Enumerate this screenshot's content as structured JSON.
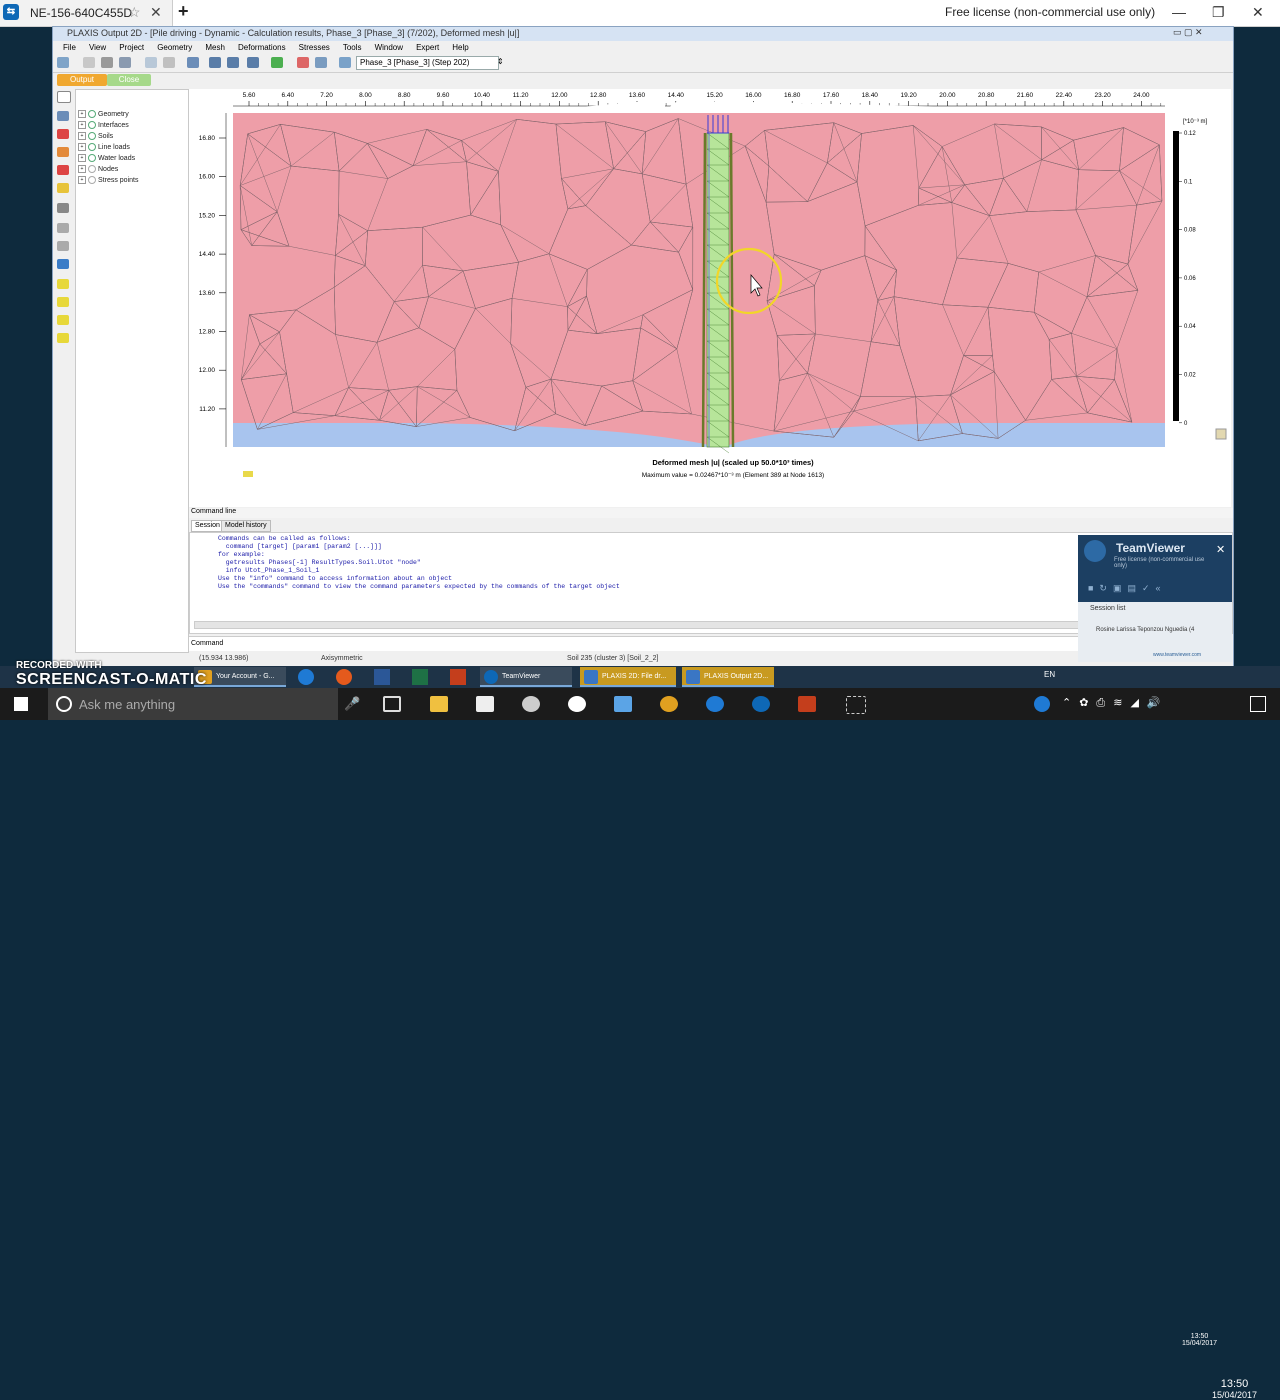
{
  "teamviewer_bar": {
    "session_tab": "NE-156-640C455D",
    "license": "Free license (non-commercial use only)"
  },
  "plaxis": {
    "title": "PLAXIS Output 2D - [Pile driving - Dynamic - Calculation results, Phase_3 [Phase_3] (7/202), Deformed mesh |u|]",
    "menu": [
      "File",
      "View",
      "Project",
      "Geometry",
      "Mesh",
      "Deformations",
      "Stresses",
      "Tools",
      "Window",
      "Expert",
      "Help"
    ],
    "phase_select": "Phase_3 [Phase_3] (Step 202)",
    "tabs": {
      "output": "Output",
      "close": "Close"
    },
    "tree": [
      "Geometry",
      "Interfaces",
      "Soils",
      "Line loads",
      "Water loads",
      "Nodes",
      "Stress points"
    ],
    "x_ticks": [
      "5.60",
      "6.40",
      "7.20",
      "8.00",
      "8.80",
      "9.60",
      "10.40",
      "11.20",
      "12.00",
      "12.80",
      "13.60",
      "14.40",
      "15.20",
      "16.00",
      "16.80",
      "17.60",
      "18.40",
      "19.20",
      "20.00",
      "20.80",
      "21.60",
      "22.40",
      "23.20",
      "24.00"
    ],
    "y_ticks": [
      "16.80",
      "16.00",
      "15.20",
      "14.40",
      "13.60",
      "12.80",
      "12.00",
      "11.20"
    ],
    "legend_unit": "[*10⁻³ m]",
    "legend_ticks": [
      "0.12",
      "0.1",
      "0.08",
      "0.06",
      "0.04",
      "0.02",
      "0"
    ],
    "caption": "Deformed mesh |u| (scaled up 50.0*10³ times)",
    "subcaption": "Maximum value = 0.02467*10⁻³ m (Element 389 at Node 1613)",
    "command_line_title": "Command line",
    "cmd_tabs": [
      "Session",
      "Model history"
    ],
    "log": [
      "Commands can be called as follows:",
      "  command [target] [param1 [param2 [...]]]",
      "for example:",
      "  getresults Phases[-1] ResultTypes.Soil.Utot \"node\"",
      "  info Utot_Phase_1_Soil_1",
      "Use the \"info\" command to access information about an object",
      "Use the \"commands\" command to view the command parameters expected by the commands of the target object"
    ],
    "command_label": "Command",
    "status": {
      "coords": "(15.934 13.986)",
      "mode": "Axisymmetric",
      "soil": "Soil 235 (cluster 3) [Soil_2_2]"
    }
  },
  "teamviewer_panel": {
    "title": "TeamViewer",
    "subtitle": "Free license (non-commercial use only)",
    "session_list": "Session list",
    "user": "Rosine Larissa Teponzou Nguedia (4",
    "link": "www.teamviewer.com"
  },
  "taskbar": {
    "search_placeholder": "Ask me anything",
    "upper_buttons": [
      "Your Account - G...",
      "TeamViewer",
      "PLAXIS 2D: File dr...",
      "PLAXIS Output 2D..."
    ],
    "clock_small": {
      "time": "13:50",
      "date": "15/04/2017"
    },
    "clock": {
      "time": "13:50",
      "date": "15/04/2017"
    },
    "lang": "EN"
  },
  "screencast": {
    "recorded": "RECORDED WITH",
    "brand": "SCREENCAST-O-MATIC"
  },
  "colors": {
    "soil": "#ee9ea8",
    "water": "#a8c4ee",
    "pile": "#b7e59a",
    "accent": "#f0a830"
  }
}
